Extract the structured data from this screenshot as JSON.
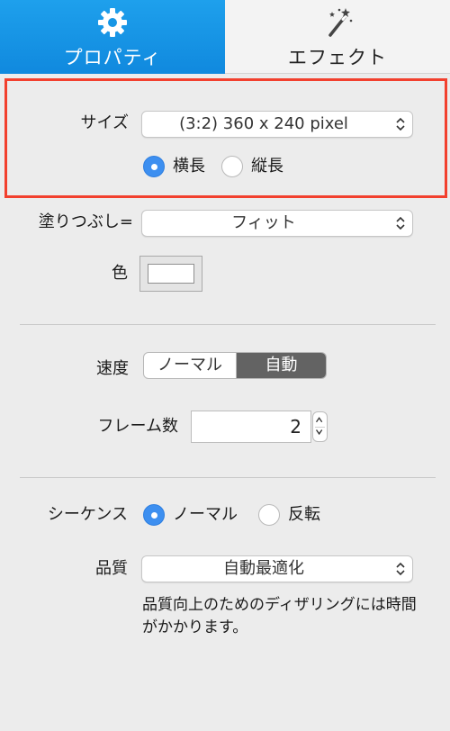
{
  "tabs": {
    "properties": {
      "label": "プロパティ",
      "icon": "gear-icon",
      "selected": true
    },
    "effect": {
      "label": "エフェクト",
      "icon": "magic-wand-icon",
      "selected": false
    }
  },
  "size": {
    "label": "サイズ",
    "value": "(3:2) 360 x 240 pixel",
    "orientation": [
      {
        "label": "横長",
        "selected": true
      },
      {
        "label": "縦長",
        "selected": false
      }
    ]
  },
  "fill": {
    "label": "塗りつぶし=",
    "value": "フィット"
  },
  "color": {
    "label": "色",
    "value": "#ffffff"
  },
  "speed": {
    "label": "速度",
    "options": [
      {
        "label": "ノーマル",
        "selected": false
      },
      {
        "label": "自動",
        "selected": true
      }
    ]
  },
  "frames": {
    "label": "フレーム数",
    "value": "2"
  },
  "sequence": {
    "label": "シーケンス",
    "options": [
      {
        "label": "ノーマル",
        "selected": true
      },
      {
        "label": "反転",
        "selected": false
      }
    ]
  },
  "quality": {
    "label": "品質",
    "value": "自動最適化",
    "note": "品質向上のためのディザリングには時間がかかります。"
  },
  "colors": {
    "accent": "#1a93e4",
    "highlight": "#f2402e",
    "radio_on": "#3d8ff0",
    "segment_selected": "#636363"
  }
}
